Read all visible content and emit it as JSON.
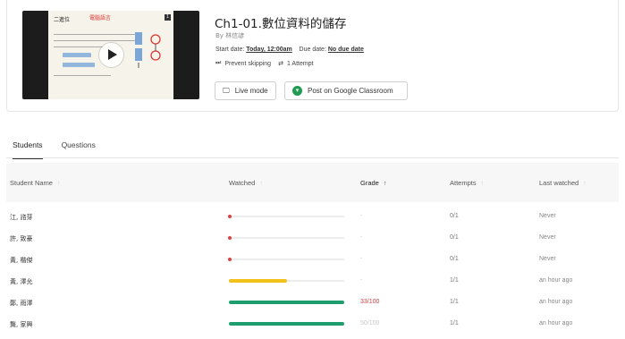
{
  "lesson": {
    "title": "Ch1-01.數位資料的儲存",
    "author": "By 林信諺",
    "start_label": "Start date:",
    "start_value": "Today, 12:00am",
    "due_label": "Due date:",
    "due_value": "No due date",
    "prevent_skipping": "Prevent skipping",
    "attempts": "1 Attempt",
    "thumbnail": {
      "slide_heading": "二進位",
      "slide_handwriting": "電腦語言",
      "slide_number": "1"
    }
  },
  "actions": {
    "live_mode": "Live mode",
    "post_classroom": "Post on Google Classroom"
  },
  "tabs": [
    {
      "label": "Students",
      "active": true
    },
    {
      "label": "Questions",
      "active": false
    }
  ],
  "table": {
    "headers": {
      "name": "Student Name",
      "watched": "Watched",
      "grade": "Grade",
      "attempts": "Attempts",
      "last_watched": "Last watched"
    },
    "sorted_by": "grade",
    "rows": [
      {
        "name": "江, 諮芽",
        "watched": 0.02,
        "bar_color": "#e04040",
        "grade": "-",
        "attempts": "0/1",
        "last_watched": "Never"
      },
      {
        "name": "許, 致豪",
        "watched": 0.02,
        "bar_color": "#e04040",
        "grade": "-",
        "attempts": "0/1",
        "last_watched": "Never"
      },
      {
        "name": "黃, 楷傑",
        "watched": 0.02,
        "bar_color": "#e04040",
        "grade": "-",
        "attempts": "0/1",
        "last_watched": "Never"
      },
      {
        "name": "黃, 澤允",
        "watched": 0.5,
        "bar_color": "#f2c21b",
        "grade": "-",
        "attempts": "1/1",
        "last_watched": "an hour ago"
      },
      {
        "name": "鄭, 雨澤",
        "watched": 1.0,
        "bar_color": "#1e9e6e",
        "grade": "33/100",
        "attempts": "1/1",
        "last_watched": "an hour ago"
      },
      {
        "name": "龔, 家興",
        "watched": 1.0,
        "bar_color": "#1e9e6e",
        "grade": "50/100",
        "attempts": "1/1",
        "last_watched": "an hour ago"
      }
    ]
  }
}
